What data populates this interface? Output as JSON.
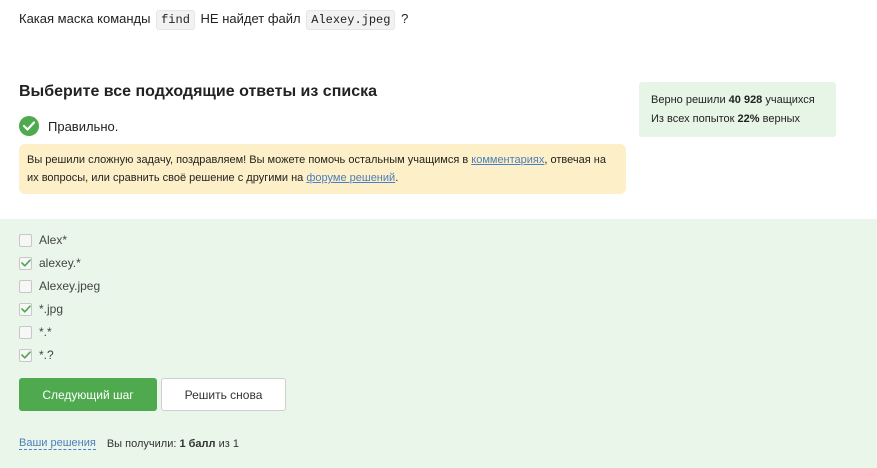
{
  "question": {
    "text_before": "Какая маска команды",
    "command": "find",
    "text_middle": "НЕ найдет файл",
    "filename": "Alexey.jpeg",
    "text_after": "?"
  },
  "heading": "Выберите все подходящие ответы из списка",
  "verdict": "Правильно.",
  "notice": {
    "text1": "Вы решили сложную задачу, поздравляем! Вы можете помочь остальным учащимся в ",
    "link1": "комментариях",
    "text2": ", отвечая на их вопросы, или сравнить своё решение с другими на ",
    "link2": "форуме решений",
    "text3": "."
  },
  "stats": {
    "solved_prefix": "Верно решили",
    "solved_count": "40 928",
    "solved_suffix": "учащихся",
    "attempts_prefix": "Из всех попыток",
    "attempts_percent": "22%",
    "attempts_suffix": "верных"
  },
  "options": [
    {
      "label": "Alex*",
      "checked": false
    },
    {
      "label": "alexey.*",
      "checked": true
    },
    {
      "label": "Alexey.jpeg",
      "checked": false
    },
    {
      "label": "*.jpg",
      "checked": true
    },
    {
      "label": "*.*",
      "checked": false
    },
    {
      "label": "*.?",
      "checked": true
    }
  ],
  "buttons": {
    "next": "Следующий шаг",
    "retry": "Решить снова"
  },
  "footer": {
    "solutions_link": "Ваши решения",
    "score_prefix": "Вы получили:",
    "score_value": "1 балл",
    "score_suffix": "из 1"
  },
  "colors": {
    "accent_green": "#4fa94f",
    "panel_green": "#e9f6e9",
    "notice_yellow": "#fdefc7",
    "link_blue": "#4a7fc0"
  }
}
